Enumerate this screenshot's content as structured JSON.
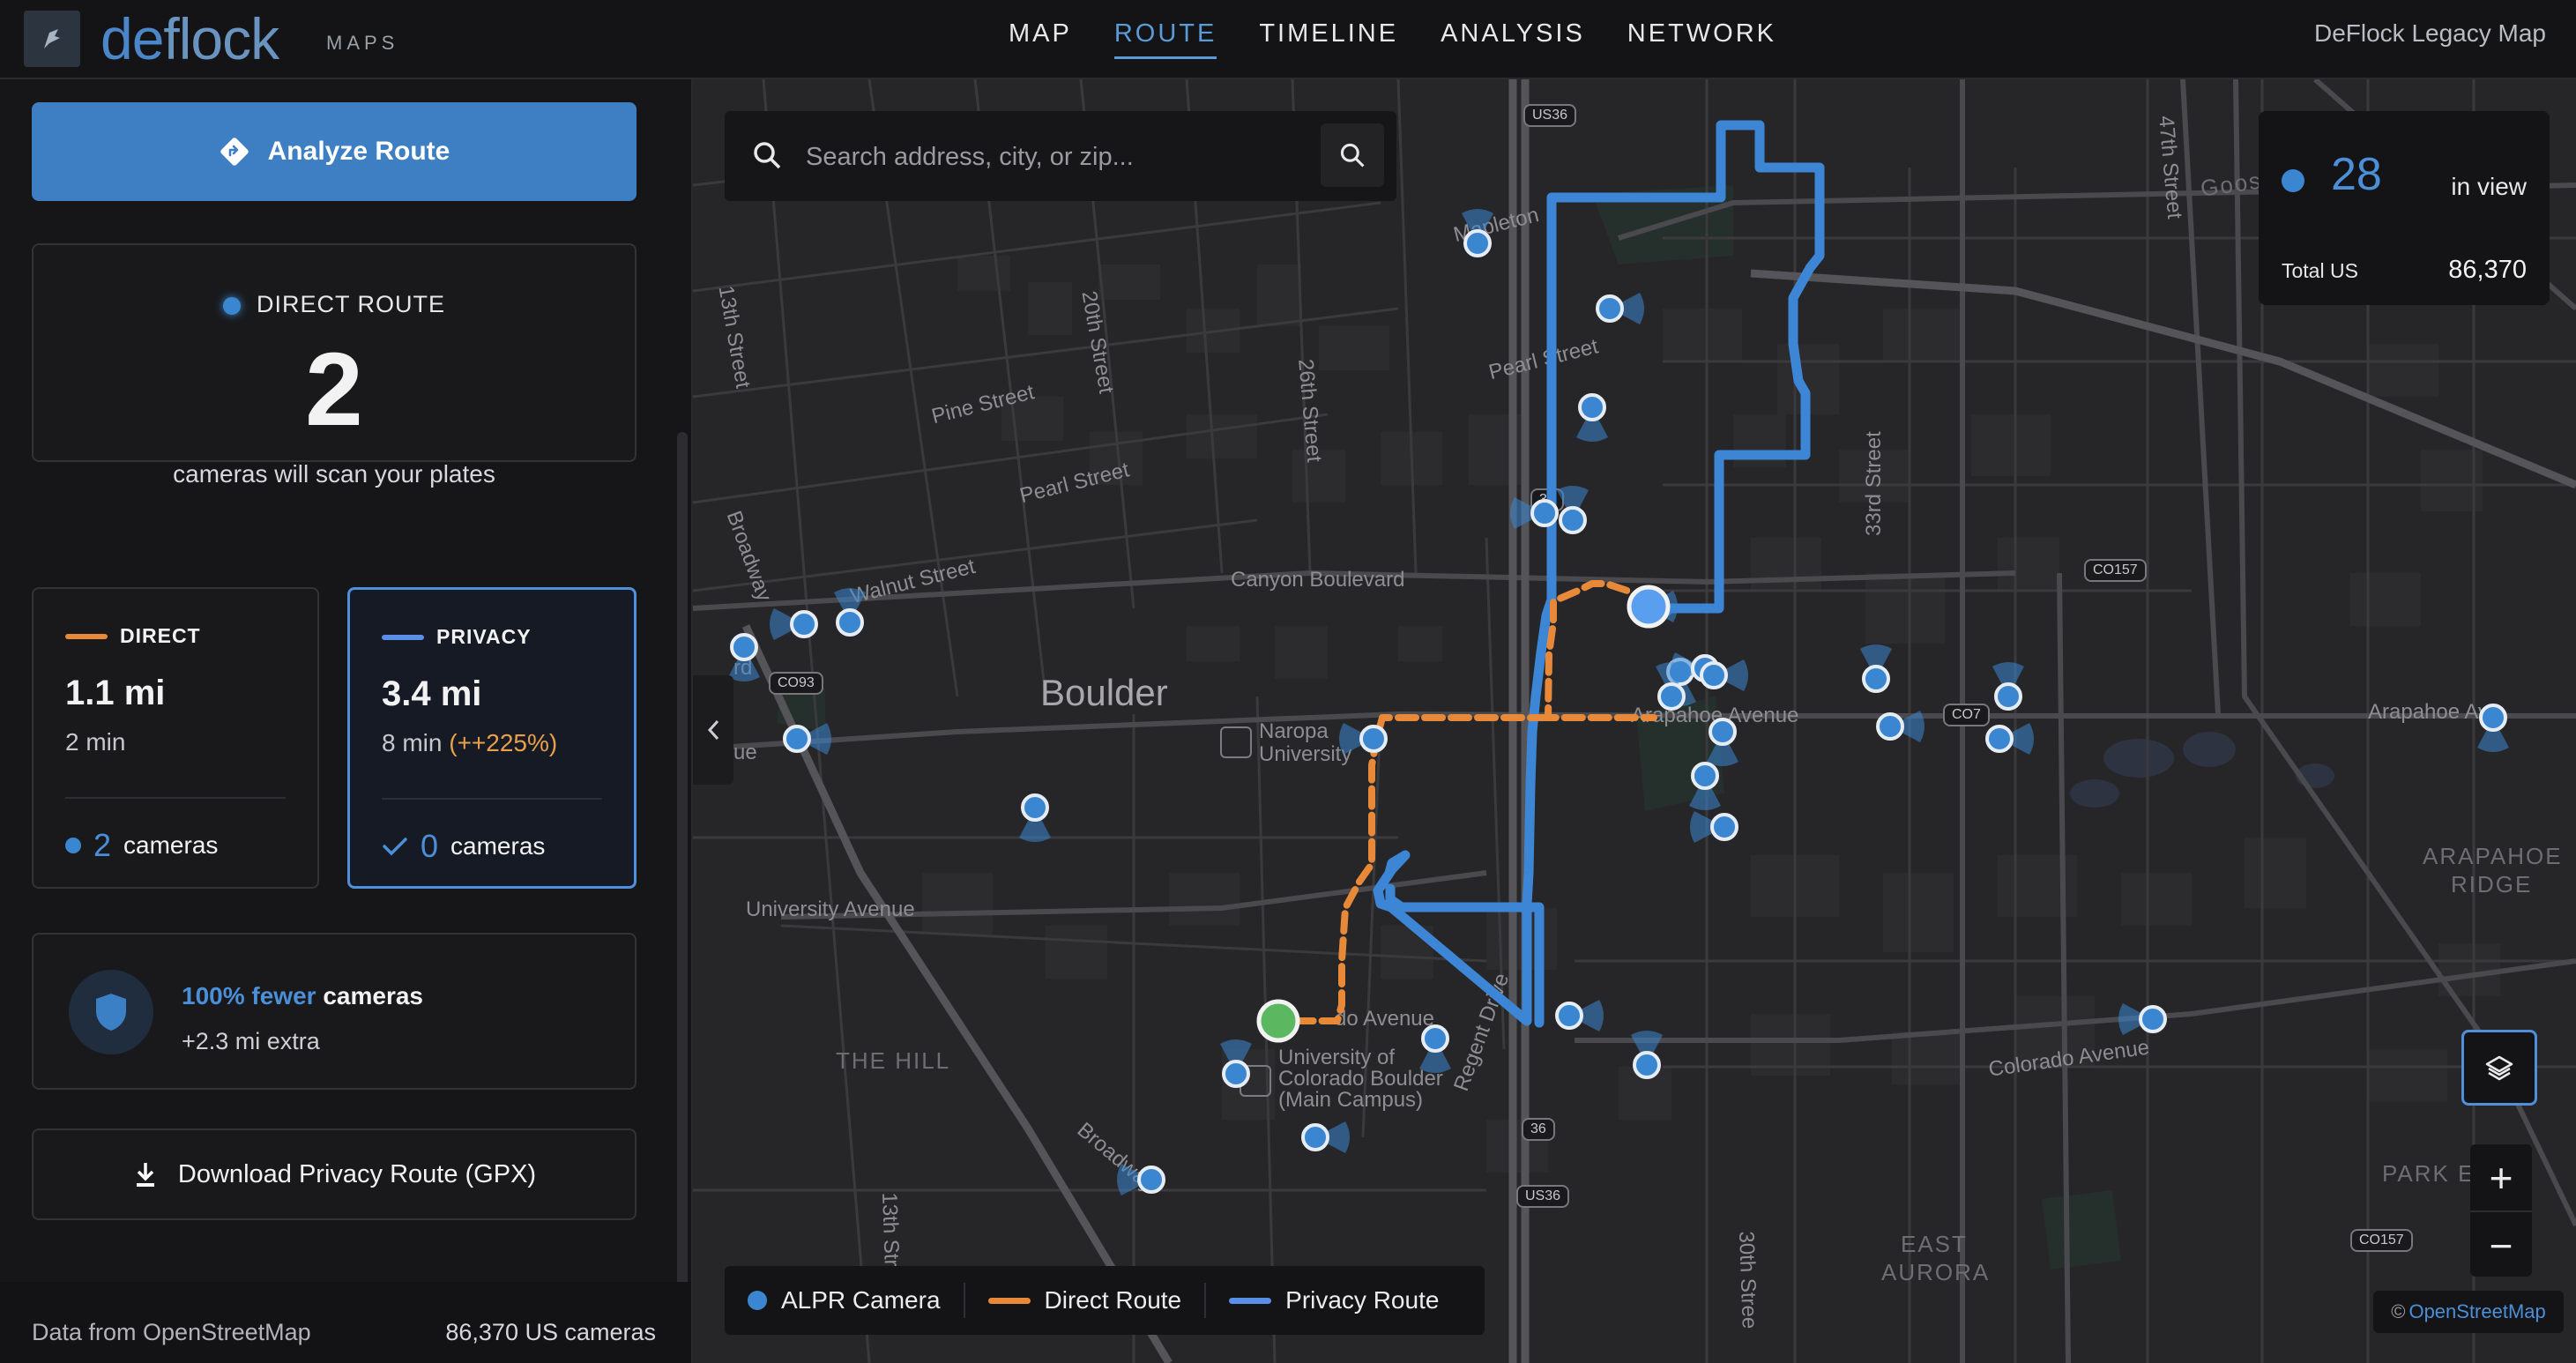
{
  "header": {
    "logo_text": "deflock",
    "logo_prefix": "de",
    "logo_suffix": "flock",
    "logo_sub": "MAPS",
    "nav": [
      {
        "label": "MAP"
      },
      {
        "label": "ROUTE",
        "active": true
      },
      {
        "label": "TIMELINE"
      },
      {
        "label": "ANALYSIS"
      },
      {
        "label": "NETWORK"
      }
    ],
    "legacy_link": "DeFlock Legacy Map"
  },
  "sidebar": {
    "analyze_button": "Analyze Route",
    "summary": {
      "label": "DIRECT ROUTE",
      "count": "2",
      "subtitle": "cameras will scan your plates"
    },
    "direct_card": {
      "title": "DIRECT",
      "distance": "1.1 mi",
      "time": "2 min",
      "cameras_count": "2",
      "cameras_label": "cameras"
    },
    "privacy_card": {
      "title": "PRIVACY",
      "distance": "3.4 mi",
      "time": "8 min",
      "time_delta": "(++225%)",
      "cameras_count": "0",
      "cameras_label": "cameras"
    },
    "savings": {
      "highlight": "100% fewer",
      "rest": "cameras",
      "extra": "+2.3 mi extra"
    },
    "download_button": "Download Privacy Route (GPX)",
    "footer": {
      "source": "Data from OpenStreetMap",
      "total": "86,370 US cameras"
    }
  },
  "map": {
    "search": {
      "placeholder": "Search address, city, or zip..."
    },
    "stats": {
      "in_view_count": "28",
      "in_view_label": "in view",
      "total_label": "Total US",
      "total_value": "86,370"
    },
    "legend": [
      {
        "label": "ALPR Camera",
        "icon": "camera-dot"
      },
      {
        "label": "Direct Route",
        "icon": "orange-line"
      },
      {
        "label": "Privacy Route",
        "icon": "blue-line"
      }
    ],
    "attribution": {
      "prefix": "©",
      "link": "OpenStreetMap"
    },
    "labels": {
      "boulder": "Boulder",
      "naropa": "Naropa University",
      "naropa_l1": "Naropa",
      "naropa_l2": "University",
      "cu_l1": "University of",
      "cu_l2": "Colorado Boulder",
      "cu_l3": "(Main Campus)",
      "the_hill": "THE HILL",
      "arapahoe_ridge_1": "ARAPAHOE",
      "arapahoe_ridge_2": "RIDGE",
      "east_aurora_1": "EAST",
      "east_aurora_2": "AURORA",
      "park_e": "PARK E",
      "goose": "Goos",
      "canyon": "Canyon Boulevard",
      "pine": "Pine Street",
      "pearl1": "Pearl Street",
      "pearl2": "Pearl Street",
      "walnut": "Walnut Street",
      "mapleton": "Mapleton",
      "arapahoe_ave": "Arapahoe Avenue",
      "arapahoe_ave2": "Arapahoe Av",
      "university": "University Avenue",
      "colorado_ave": "Colorado Avenue",
      "colorado_ave2": "do Avenue",
      "broadway1": "Broadway",
      "broadway2": "Broadway",
      "regent": "Regent Drive",
      "st13": "13th Street",
      "st13b": "13th Str",
      "st20": "20th Street",
      "st26": "26th Street",
      "st30": "30th Stree",
      "st33": "33rd Street",
      "st47": "47th Street",
      "ue": "ue",
      "rd": "rd"
    },
    "shields": [
      "US36",
      "CO93",
      "CO157",
      "CO157",
      "CO7",
      "36",
      "US36",
      "CO157",
      "30"
    ]
  }
}
